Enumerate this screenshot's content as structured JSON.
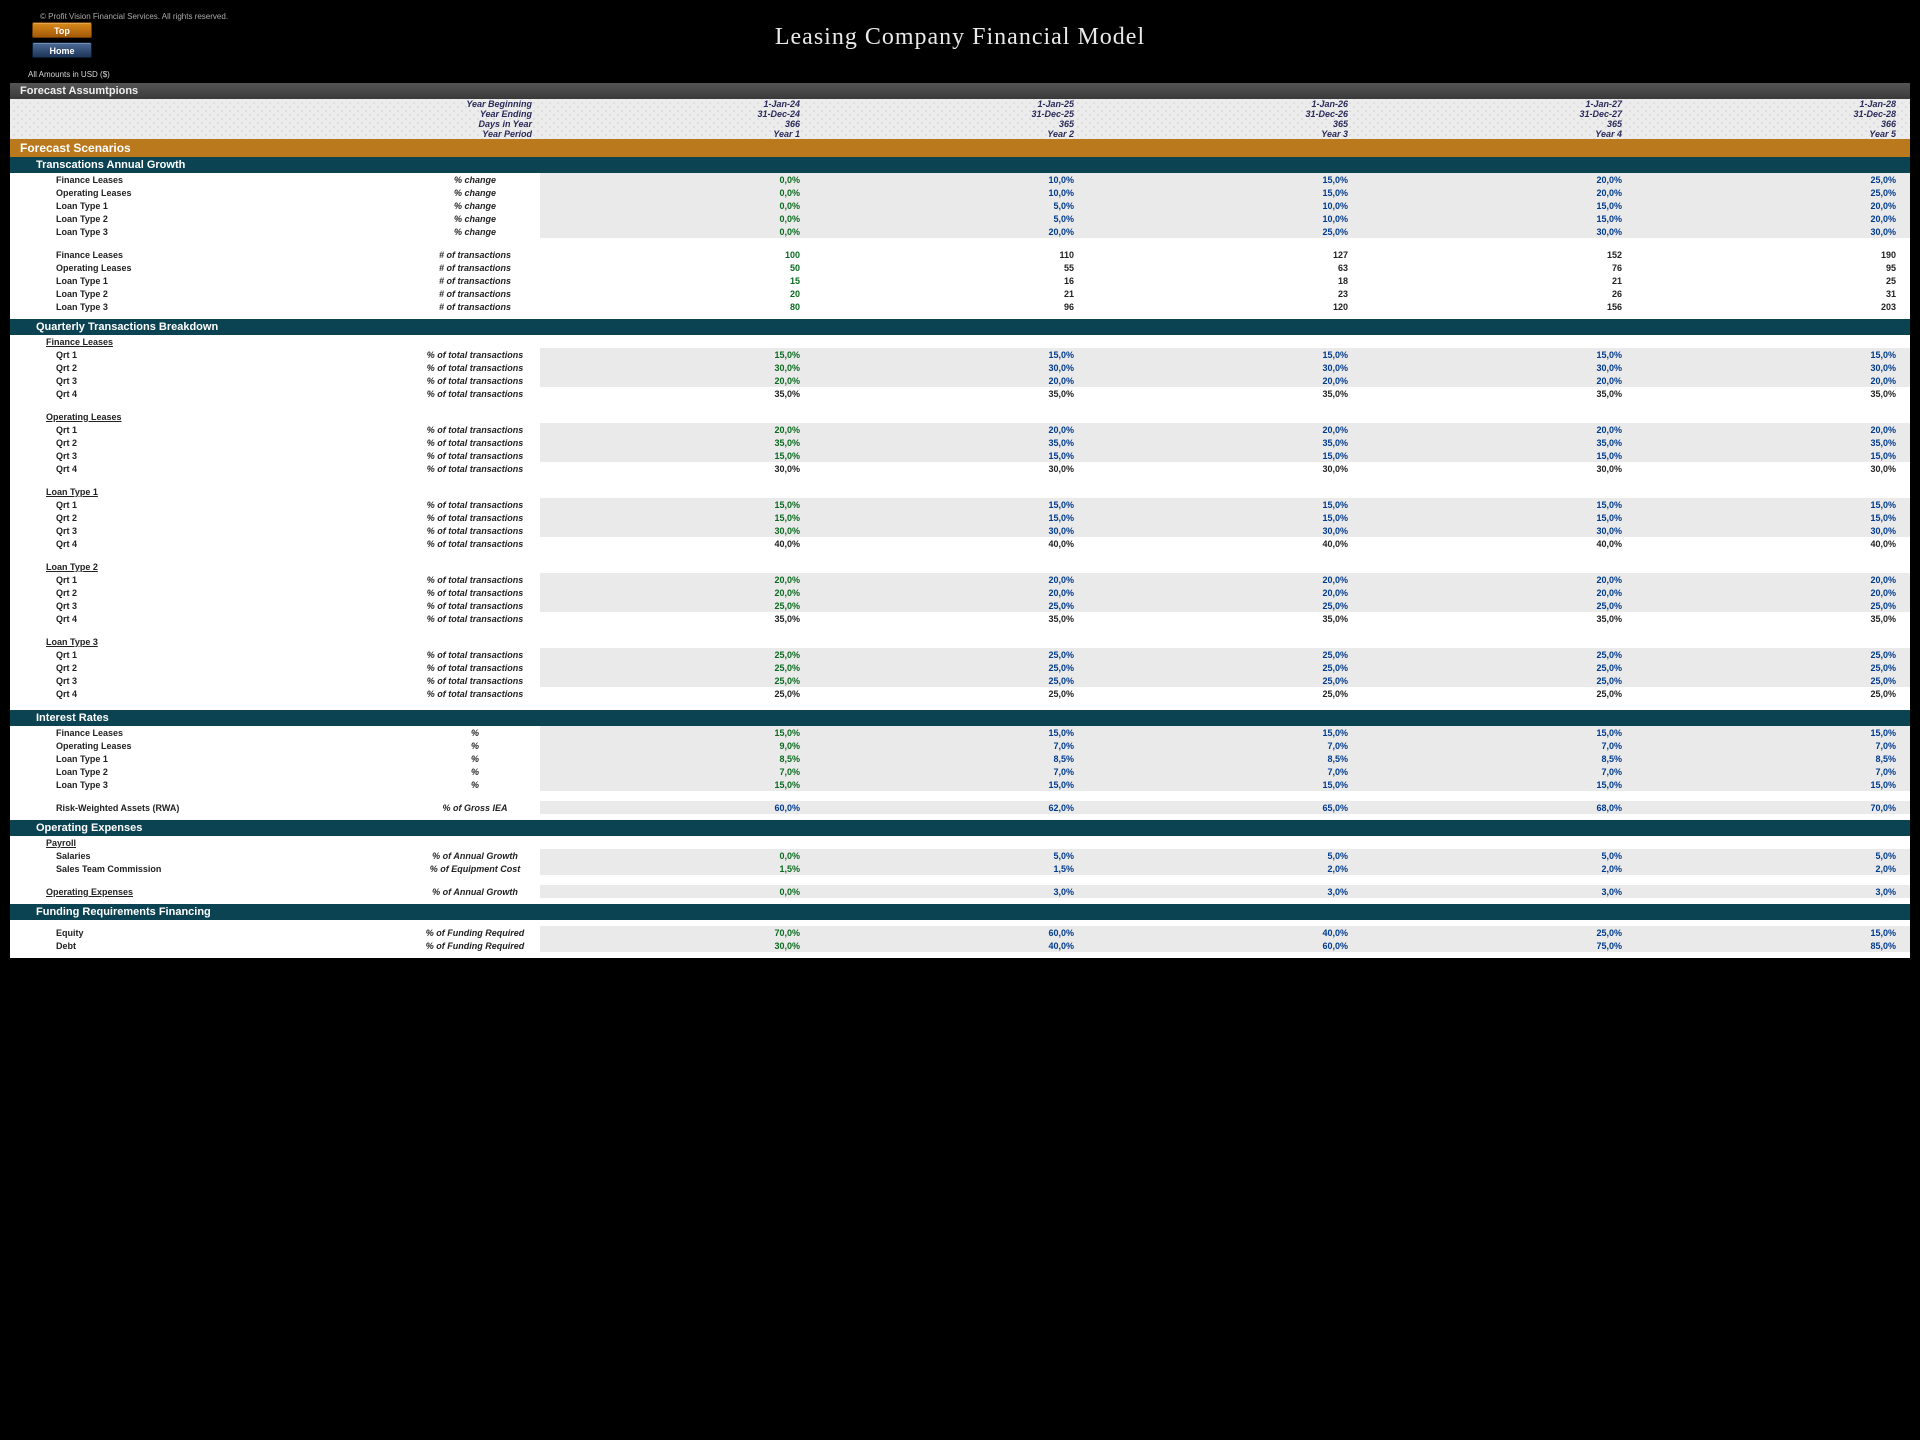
{
  "copyright": "© Profit Vision Financial Services. All rights reserved.",
  "buttons": {
    "top": "Top",
    "home": "Home"
  },
  "title": "Leasing Company Financial Model",
  "currency_note": "All Amounts in  USD ($)",
  "assumptions_header": "Forecast Assumtpions",
  "assump_rows": {
    "year_beginning": {
      "label": "Year Beginning",
      "values": [
        "1-Jan-24",
        "1-Jan-25",
        "1-Jan-26",
        "1-Jan-27",
        "1-Jan-28"
      ]
    },
    "year_ending": {
      "label": "Year Ending",
      "values": [
        "31-Dec-24",
        "31-Dec-25",
        "31-Dec-26",
        "31-Dec-27",
        "31-Dec-28"
      ]
    },
    "days_in_year": {
      "label": "Days in Year",
      "values": [
        "366",
        "365",
        "365",
        "365",
        "366"
      ]
    },
    "year_period": {
      "label": "Year Period",
      "values": [
        "Year 1",
        "Year 2",
        "Year 3",
        "Year 4",
        "Year 5"
      ]
    }
  },
  "scenarios_header": "Forecast Scenarios",
  "growth_header": "Transcations Annual Growth",
  "pct_change_unit": "% change",
  "growth": {
    "finance_leases": {
      "label": "Finance Leases",
      "values": [
        "0,0%",
        "10,0%",
        "15,0%",
        "20,0%",
        "25,0%"
      ]
    },
    "operating_leases": {
      "label": "Operating Leases",
      "values": [
        "0,0%",
        "10,0%",
        "15,0%",
        "20,0%",
        "25,0%"
      ]
    },
    "loan_type_1": {
      "label": "Loan Type 1",
      "values": [
        "0,0%",
        "5,0%",
        "10,0%",
        "15,0%",
        "20,0%"
      ]
    },
    "loan_type_2": {
      "label": "Loan Type 2",
      "values": [
        "0,0%",
        "5,0%",
        "10,0%",
        "15,0%",
        "20,0%"
      ]
    },
    "loan_type_3": {
      "label": "Loan Type 3",
      "values": [
        "0,0%",
        "20,0%",
        "25,0%",
        "30,0%",
        "30,0%"
      ]
    }
  },
  "trans_unit": "# of transactions",
  "transactions": {
    "finance_leases": {
      "label": "Finance Leases",
      "values": [
        "100",
        "110",
        "127",
        "152",
        "190"
      ]
    },
    "operating_leases": {
      "label": "Operating Leases",
      "values": [
        "50",
        "55",
        "63",
        "76",
        "95"
      ]
    },
    "loan_type_1": {
      "label": "Loan Type 1",
      "values": [
        "15",
        "16",
        "18",
        "21",
        "25"
      ]
    },
    "loan_type_2": {
      "label": "Loan Type 2",
      "values": [
        "20",
        "21",
        "23",
        "26",
        "31"
      ]
    },
    "loan_type_3": {
      "label": "Loan Type 3",
      "values": [
        "80",
        "96",
        "120",
        "156",
        "203"
      ]
    }
  },
  "quarterly_header": "Quarterly Transactions Breakdown",
  "pct_total_unit": "% of total transactions",
  "quarters": {
    "finance_leases": {
      "label": "Finance Leases",
      "q1": [
        "15,0%",
        "15,0%",
        "15,0%",
        "15,0%",
        "15,0%"
      ],
      "q2": [
        "30,0%",
        "30,0%",
        "30,0%",
        "30,0%",
        "30,0%"
      ],
      "q3": [
        "20,0%",
        "20,0%",
        "20,0%",
        "20,0%",
        "20,0%"
      ],
      "q4": [
        "35,0%",
        "35,0%",
        "35,0%",
        "35,0%",
        "35,0%"
      ]
    },
    "operating_leases": {
      "label": "Operating Leases",
      "q1": [
        "20,0%",
        "20,0%",
        "20,0%",
        "20,0%",
        "20,0%"
      ],
      "q2": [
        "35,0%",
        "35,0%",
        "35,0%",
        "35,0%",
        "35,0%"
      ],
      "q3": [
        "15,0%",
        "15,0%",
        "15,0%",
        "15,0%",
        "15,0%"
      ],
      "q4": [
        "30,0%",
        "30,0%",
        "30,0%",
        "30,0%",
        "30,0%"
      ]
    },
    "loan_type_1": {
      "label": "Loan Type 1",
      "q1": [
        "15,0%",
        "15,0%",
        "15,0%",
        "15,0%",
        "15,0%"
      ],
      "q2": [
        "15,0%",
        "15,0%",
        "15,0%",
        "15,0%",
        "15,0%"
      ],
      "q3": [
        "30,0%",
        "30,0%",
        "30,0%",
        "30,0%",
        "30,0%"
      ],
      "q4": [
        "40,0%",
        "40,0%",
        "40,0%",
        "40,0%",
        "40,0%"
      ]
    },
    "loan_type_2": {
      "label": "Loan Type 2",
      "q1": [
        "20,0%",
        "20,0%",
        "20,0%",
        "20,0%",
        "20,0%"
      ],
      "q2": [
        "20,0%",
        "20,0%",
        "20,0%",
        "20,0%",
        "20,0%"
      ],
      "q3": [
        "25,0%",
        "25,0%",
        "25,0%",
        "25,0%",
        "25,0%"
      ],
      "q4": [
        "35,0%",
        "35,0%",
        "35,0%",
        "35,0%",
        "35,0%"
      ]
    },
    "loan_type_3": {
      "label": "Loan Type 3",
      "q1": [
        "25,0%",
        "25,0%",
        "25,0%",
        "25,0%",
        "25,0%"
      ],
      "q2": [
        "25,0%",
        "25,0%",
        "25,0%",
        "25,0%",
        "25,0%"
      ],
      "q3": [
        "25,0%",
        "25,0%",
        "25,0%",
        "25,0%",
        "25,0%"
      ],
      "q4": [
        "25,0%",
        "25,0%",
        "25,0%",
        "25,0%",
        "25,0%"
      ]
    }
  },
  "q_labels": {
    "q1": "Qrt 1",
    "q2": "Qrt 2",
    "q3": "Qrt 3",
    "q4": "Qrt 4"
  },
  "interest_header": "Interest Rates",
  "pct_unit": "%",
  "interest": {
    "finance_leases": {
      "label": "Finance Leases",
      "values": [
        "15,0%",
        "15,0%",
        "15,0%",
        "15,0%",
        "15,0%"
      ]
    },
    "operating_leases": {
      "label": "Operating Leases",
      "values": [
        "9,0%",
        "7,0%",
        "7,0%",
        "7,0%",
        "7,0%"
      ]
    },
    "loan_type_1": {
      "label": "Loan Type 1",
      "values": [
        "8,5%",
        "8,5%",
        "8,5%",
        "8,5%",
        "8,5%"
      ]
    },
    "loan_type_2": {
      "label": "Loan Type 2",
      "values": [
        "7,0%",
        "7,0%",
        "7,0%",
        "7,0%",
        "7,0%"
      ]
    },
    "loan_type_3": {
      "label": "Loan Type 3",
      "values": [
        "15,0%",
        "15,0%",
        "15,0%",
        "15,0%",
        "15,0%"
      ]
    }
  },
  "rwa": {
    "label": "Risk-Weighted Assets (RWA)",
    "unit": "% of Gross IEA",
    "values": [
      "60,0%",
      "62,0%",
      "65,0%",
      "68,0%",
      "70,0%"
    ]
  },
  "opex_header": "Operating Expenses",
  "payroll_label": "Payroll",
  "salaries": {
    "label": "Salaries",
    "unit": "% of Annual Growth",
    "values": [
      "0,0%",
      "5,0%",
      "5,0%",
      "5,0%",
      "5,0%"
    ]
  },
  "commission": {
    "label": "Sales Team Commission",
    "unit": "% of Equipment Cost",
    "values": [
      "1,5%",
      "1,5%",
      "2,0%",
      "2,0%",
      "2,0%"
    ]
  },
  "opex_row": {
    "label": "Operating Expenses",
    "unit": "% of Annual Growth",
    "values": [
      "0,0%",
      "3,0%",
      "3,0%",
      "3,0%",
      "3,0%"
    ]
  },
  "funding_header": "Funding Requirements Financing",
  "funding_unit": "% of Funding Required",
  "equity": {
    "label": "Equity",
    "values": [
      "70,0%",
      "60,0%",
      "40,0%",
      "25,0%",
      "15,0%"
    ]
  },
  "debt": {
    "label": "Debt",
    "values": [
      "30,0%",
      "40,0%",
      "60,0%",
      "75,0%",
      "85,0%"
    ]
  }
}
